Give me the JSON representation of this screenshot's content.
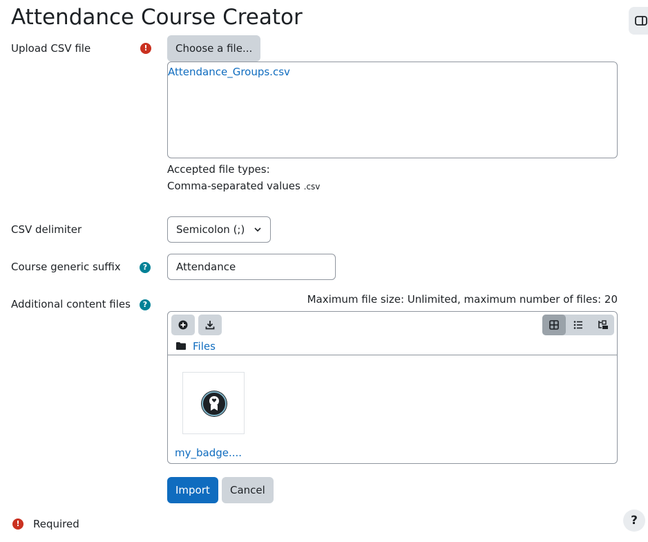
{
  "page": {
    "title": "Attendance Course Creator"
  },
  "upload": {
    "label": "Upload CSV file",
    "choose_button": "Choose a file...",
    "selected_file": "Attendance_Groups.csv",
    "accepted_types_label": "Accepted file types:",
    "accepted_type_name": "Comma-separated values",
    "accepted_type_ext": ".csv"
  },
  "delimiter": {
    "label": "CSV delimiter",
    "selected": "Semicolon (;)"
  },
  "suffix": {
    "label": "Course generic suffix",
    "value": "Attendance"
  },
  "content_files": {
    "label": "Additional content files",
    "max_info": "Maximum file size: Unlimited, maximum number of files: 20",
    "breadcrumb": "Files",
    "files": [
      {
        "name": "my_badge...."
      }
    ]
  },
  "actions": {
    "import_label": "Import",
    "cancel_label": "Cancel"
  },
  "footer": {
    "required_label": "Required"
  },
  "help_fab": "?",
  "icons": {
    "required": "exclamation-circle-icon",
    "help": "question-circle-icon",
    "add": "plus-circle-icon",
    "download": "download-icon",
    "grid": "grid-view-icon",
    "list": "list-view-icon",
    "tree": "tree-view-icon",
    "folder": "folder-icon",
    "drawer": "sidebar-toggle-icon",
    "badge": "badge-icon"
  },
  "colors": {
    "primary": "#0f6cbf",
    "required_red": "#ca3120",
    "help_teal": "#008196",
    "secondary_button": "#ced4da"
  }
}
